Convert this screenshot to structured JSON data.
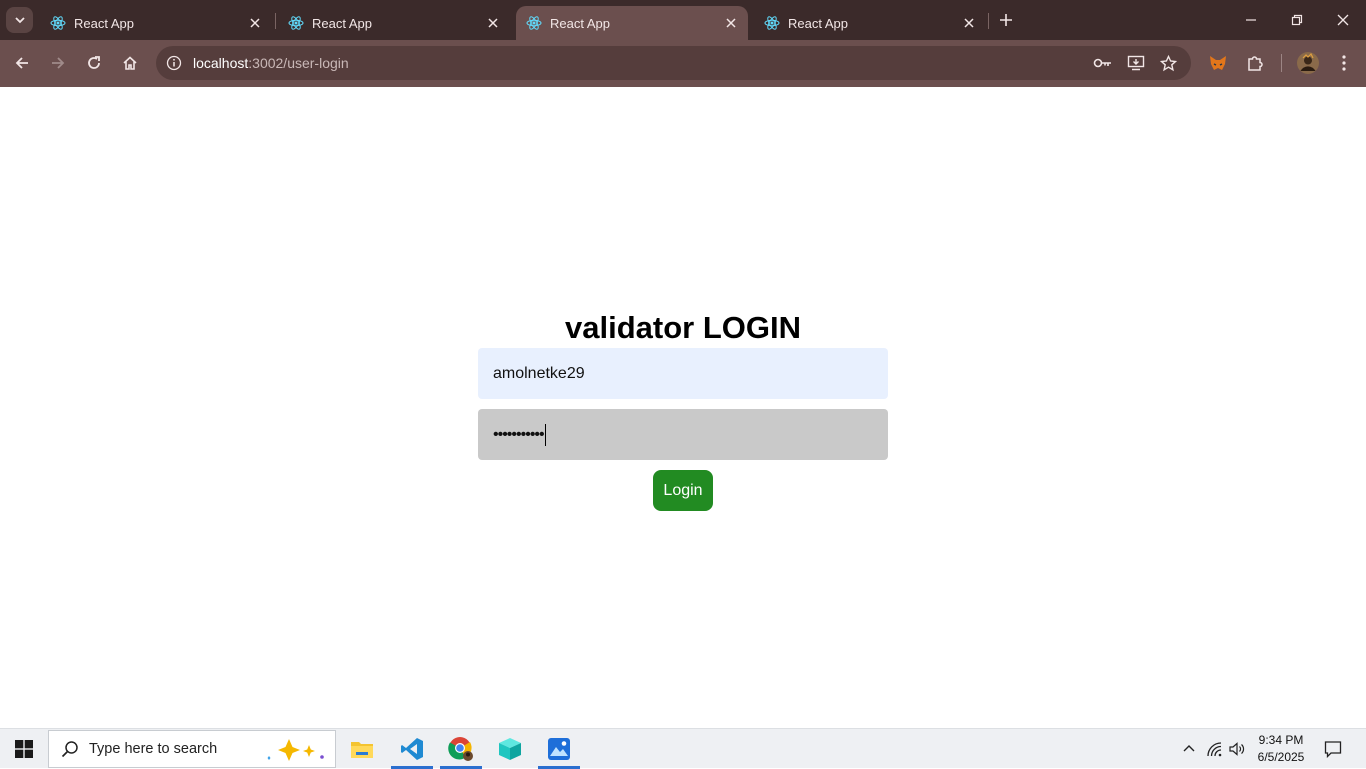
{
  "browser": {
    "tabs": [
      {
        "title": "React App",
        "active": false
      },
      {
        "title": "React App",
        "active": false
      },
      {
        "title": "React App",
        "active": true
      },
      {
        "title": "React App",
        "active": false
      }
    ],
    "url_host": "localhost",
    "url_rest": ":3002/user-login",
    "icons": {
      "tab_search": "chevron-down-icon",
      "favicon": "react-logo-icon",
      "close": "close-icon",
      "new_tab": "plus-icon",
      "back": "back-arrow-icon",
      "forward": "forward-arrow-icon",
      "reload": "reload-icon",
      "home": "home-icon",
      "site_info": "site-info-icon",
      "password": "key-icon",
      "install": "install-app-icon",
      "bookmark": "star-icon",
      "metamask": "fox-extension-icon",
      "extensions": "puzzle-icon",
      "profile": "avatar",
      "menu": "kebab-menu-icon"
    }
  },
  "login": {
    "title": "validator LOGIN",
    "username_value": "amolnetke29",
    "password_value": "•••••••••••",
    "button_label": "Login"
  },
  "taskbar": {
    "search_placeholder": "Type here to search",
    "time": "9:34 PM",
    "date": "6/5/2025",
    "apps": [
      "file-explorer-icon",
      "vscode-icon",
      "chrome-icon",
      "3d-box-app-icon",
      "photos-icon"
    ]
  },
  "colors": {
    "tab_strip": "#3b2a2a",
    "toolbar": "#6b4f4e",
    "omnibox": "#553d3c",
    "username_bg": "#e8f0fe",
    "password_bg": "#c9c9c9",
    "login_button": "#228b22"
  }
}
